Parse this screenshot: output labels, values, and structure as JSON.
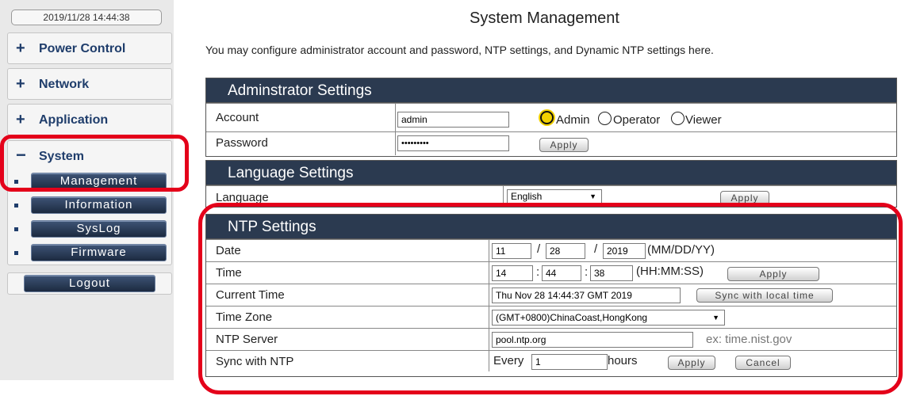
{
  "sidebar": {
    "datetime": "2019/11/28 14:44:38",
    "menus": [
      {
        "label": "Power Control",
        "symbol": "+"
      },
      {
        "label": "Network",
        "symbol": "+"
      },
      {
        "label": "Application",
        "symbol": "+"
      }
    ],
    "system": {
      "label": "System",
      "symbol": "−",
      "items": [
        "Management",
        "Information",
        "SysLog",
        "Firmware"
      ]
    },
    "logout_label": "Logout"
  },
  "main": {
    "title": "System Management",
    "description": "You may configure administrator account and password, NTP settings, and Dynamic NTP settings here.",
    "admin": {
      "heading": "Adminstrator Settings",
      "account_label": "Account",
      "account_value": "admin",
      "roles": [
        "Admin",
        "Operator",
        "Viewer"
      ],
      "selected_role": "Admin",
      "password_label": "Password",
      "password_mask": "•••••••••",
      "apply_label": "Apply"
    },
    "language": {
      "heading": "Language Settings",
      "label": "Language",
      "selected": "English",
      "apply_label": "Apply"
    },
    "ntp": {
      "heading": "NTP Settings",
      "date_label": "Date",
      "month": "11",
      "day": "28",
      "year": "2019",
      "date_sep": "/",
      "date_format": "(MM/DD/YY)",
      "time_label": "Time",
      "hour": "14",
      "minute": "44",
      "second": "38",
      "time_sep": ":",
      "time_format": "(HH:MM:SS)",
      "apply_label": "Apply",
      "current_time_label": "Current Time",
      "current_time_value": "Thu Nov 28 14:44:37 GMT 2019",
      "sync_local_label": "Sync with local time",
      "timezone_label": "Time Zone",
      "timezone_value": "(GMT+0800)ChinaCoast,HongKong",
      "server_label": "NTP Server",
      "server_value": "pool.ntp.org",
      "server_hint": "ex: time.nist.gov",
      "sync_label": "Sync with NTP",
      "every_label": "Every",
      "every_value": "1",
      "hours_label": "hours",
      "cancel_label": "Cancel"
    }
  },
  "colors": {
    "highlight": "#e4001a",
    "section_header": "#2b3a50",
    "nav_text": "#1f3d6b",
    "selected_radio": "#f2d100"
  },
  "icons": {
    "dropdown": "triangle-down"
  }
}
